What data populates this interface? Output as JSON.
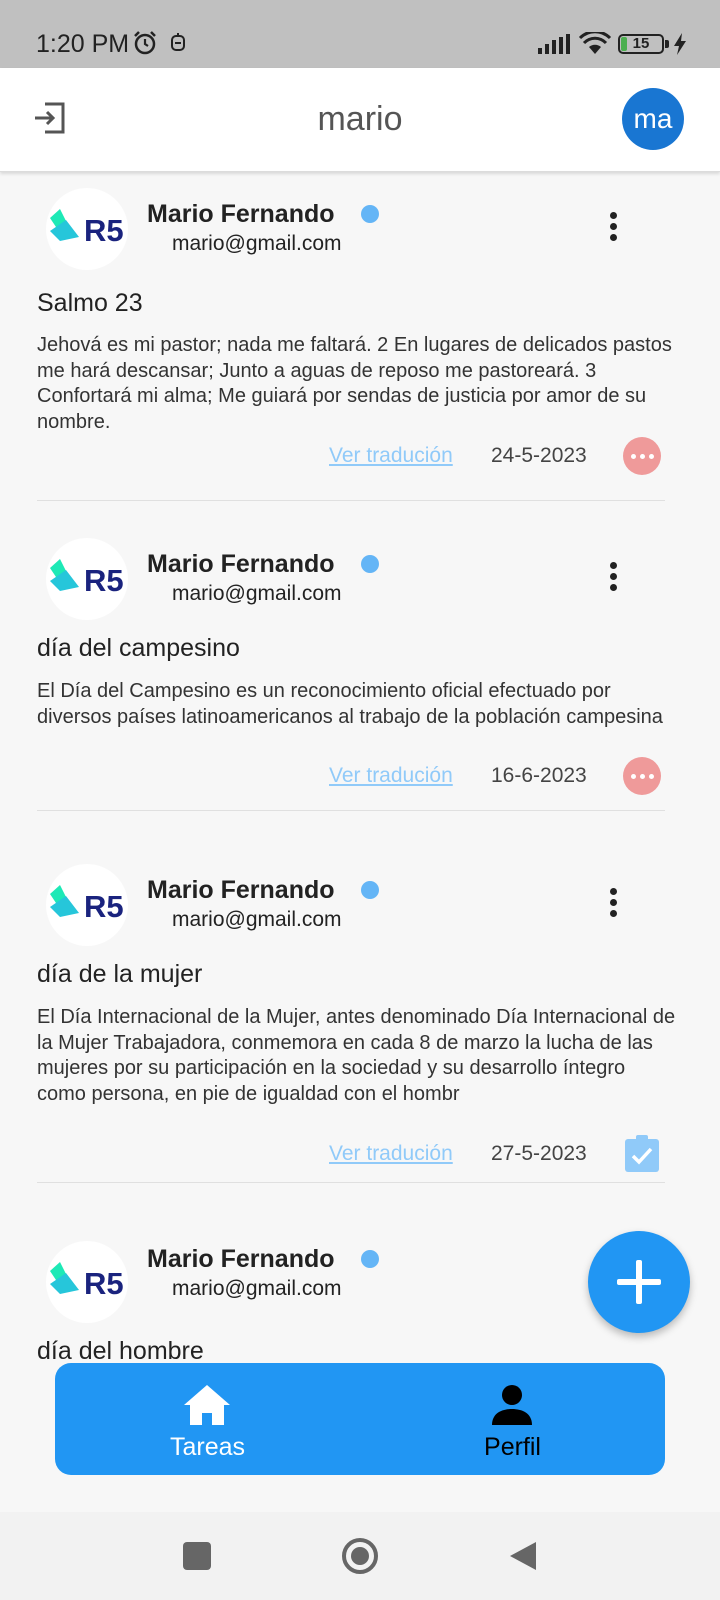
{
  "status_bar": {
    "time": "1:20 PM",
    "battery": "15",
    "icons": [
      "alarm-icon",
      "notification-icon",
      "signal-icon",
      "wifi-icon",
      "battery-icon",
      "charging-icon"
    ]
  },
  "app_bar": {
    "title": "mario",
    "avatar_initials": "ma",
    "logout_icon": "logout-icon"
  },
  "feed": {
    "posts": [
      {
        "author": "Mario Fernando",
        "email": "mario@gmail.com",
        "logo_text": "R5",
        "title": "Salmo 23",
        "body": "Jehová es mi pastor; nada me faltará.  2 En lugares de delicados pastos me hará descansar;  Junto a aguas de reposo me pastoreará.  3 Confortará mi alma;  Me guiará por sendas de justicia por amor de su nombre.",
        "translate_label": "Ver tradución",
        "date": "24-5-2023",
        "status": "pending"
      },
      {
        "author": "Mario Fernando",
        "email": "mario@gmail.com",
        "logo_text": "R5",
        "title": "día del campesino",
        "body": "El Día del Campesino es un reconocimiento oficial efectuado por diversos países latinoamericanos al trabajo de la población campesina",
        "translate_label": "Ver tradución",
        "date": "16-6-2023",
        "status": "pending"
      },
      {
        "author": "Mario Fernando",
        "email": "mario@gmail.com",
        "logo_text": "R5",
        "title": "día de la mujer",
        "body": "El Día Internacional de la Mujer, antes denominado Día Internacional de la Mujer Trabajadora,  conmemora en cada 8 de marzo la lucha de las mujeres por su participación en la sociedad y su desarrollo íntegro como persona, en pie de igualdad con el hombr",
        "translate_label": "Ver tradución",
        "date": "27-5-2023",
        "status": "done"
      },
      {
        "author": "Mario Fernando",
        "email": "mario@gmail.com",
        "logo_text": "R5",
        "title": "día del hombre"
      }
    ]
  },
  "fab": {
    "icon": "plus-icon"
  },
  "bottom_nav": {
    "items": [
      {
        "label": "Tareas",
        "icon": "home-icon",
        "active": true
      },
      {
        "label": "Perfil",
        "icon": "person-icon",
        "active": false
      }
    ]
  },
  "colors": {
    "primary": "#2196f3",
    "avatar": "#1976d2",
    "pending_badge": "#ef9a9a",
    "done_badge": "#90caf9",
    "link": "#90caf9",
    "online_dot": "#64b5f6"
  }
}
